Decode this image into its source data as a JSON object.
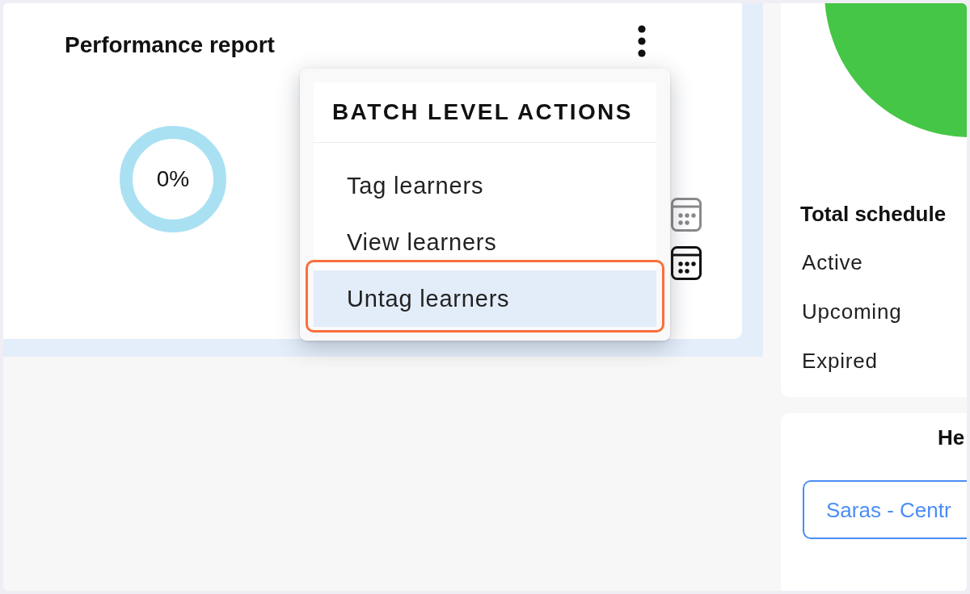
{
  "performance_report": {
    "title": "Performance report",
    "reading": "0%",
    "date_buttons": [
      {
        "selected": false
      },
      {
        "selected": true
      }
    ]
  },
  "menu": {
    "title": "BATCH LEVEL ACTIONS",
    "items": [
      {
        "label": "Tag learners",
        "selected": false,
        "highlighted": false
      },
      {
        "label": "View learners",
        "selected": false,
        "highlighted": false
      },
      {
        "label": "Untag learners",
        "selected": true,
        "highlighted": true
      }
    ]
  },
  "schedule_panel": {
    "title": "Total schedule",
    "rows": [
      "Active",
      "Upcoming",
      "Expired"
    ]
  },
  "second_panel": {
    "title": "He",
    "button": "Saras - Centr"
  }
}
